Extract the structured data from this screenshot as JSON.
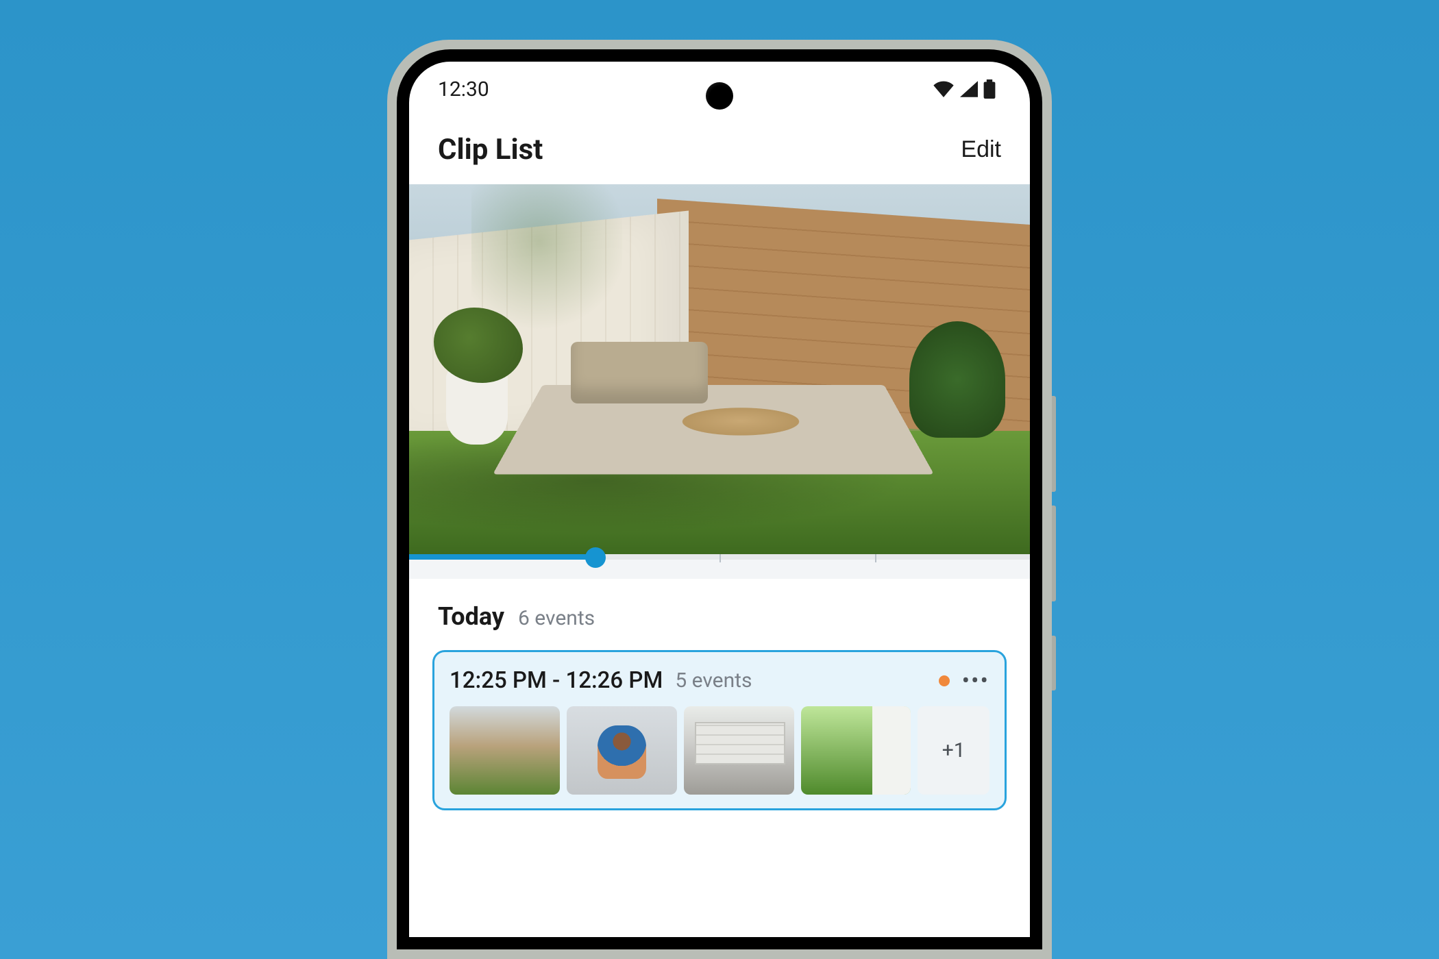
{
  "status": {
    "time": "12:30"
  },
  "header": {
    "title": "Clip List",
    "edit_label": "Edit"
  },
  "section": {
    "title": "Today",
    "subtitle": "6 events"
  },
  "clip": {
    "time_range": "12:25 PM - 12:26 PM",
    "subtitle": "5 events",
    "overflow_label": "+1",
    "thumbnails": [
      "backyard-patio",
      "family-front-door",
      "garage-interior",
      "garden-path"
    ]
  },
  "colors": {
    "accent": "#1694d1",
    "event_dot": "#f0883b"
  },
  "scrubber": {
    "progress_pct": 30
  }
}
